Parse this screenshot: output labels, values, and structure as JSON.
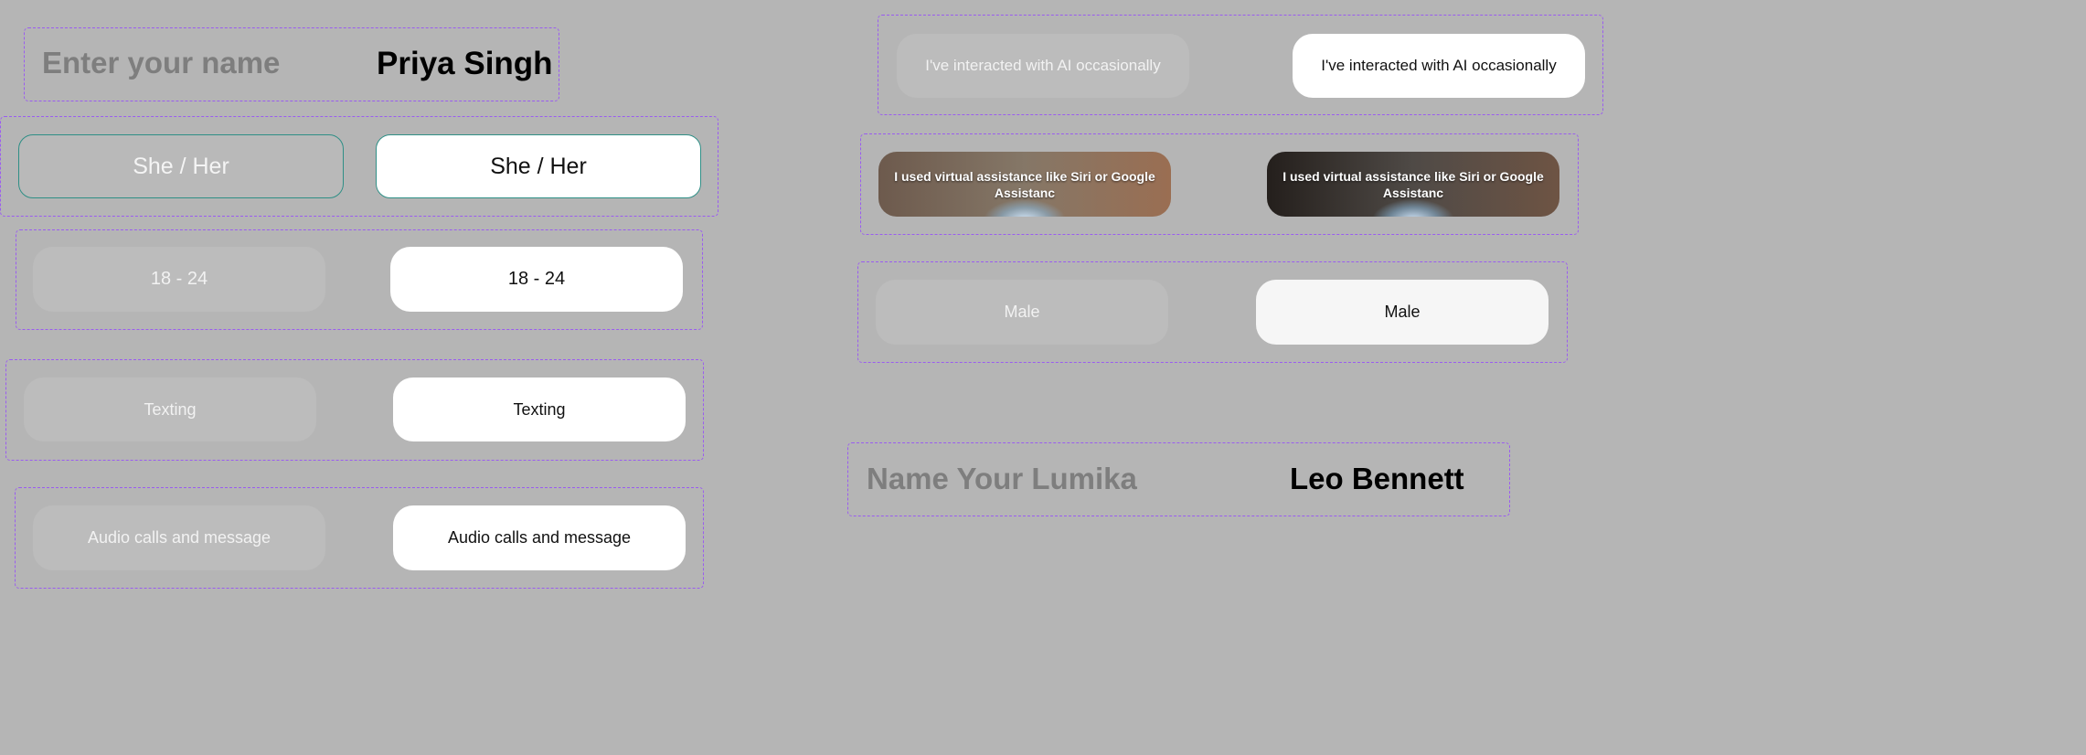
{
  "name_field": {
    "placeholder": "Enter your name",
    "value": "Priya Singh"
  },
  "pronouns": {
    "label_inactive": "She / Her",
    "label_active": "She / Her"
  },
  "age_range": {
    "label_inactive": "18 - 24",
    "label_active": "18 - 24"
  },
  "communication": {
    "label_inactive": "Texting",
    "label_active": "Texting"
  },
  "calls": {
    "label_inactive": "Audio calls and message",
    "label_active": "Audio calls and message"
  },
  "ai_experience": {
    "label_inactive": "I've interacted with AI occasionally",
    "label_active": "I've interacted with AI occasionally"
  },
  "assistant_experience": {
    "label_inactive": "I used virtual assistance like Siri or Google Assistanc",
    "label_active": "I used virtual assistance like Siri or Google Assistanc"
  },
  "gender": {
    "label_inactive": "Male",
    "label_active": "Male"
  },
  "lumika_name_field": {
    "placeholder": "Name Your Lumika",
    "value": "Leo Bennett"
  },
  "colors": {
    "background": "#b5b5b5",
    "dashed_border": "#9a5cf0",
    "outline_teal": "#2f8f86",
    "active_fill": "#ffffff",
    "inactive_fill": "#bcbcbc"
  }
}
